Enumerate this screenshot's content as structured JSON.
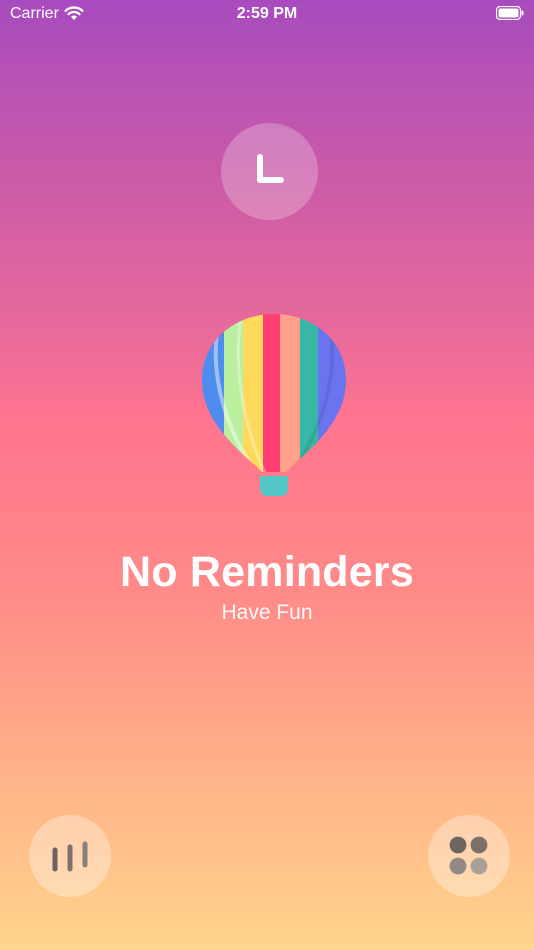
{
  "status_bar": {
    "carrier": "Carrier",
    "time": "2:59 PM"
  },
  "empty_state": {
    "title": "No Reminders",
    "subtitle": "Have Fun"
  },
  "colors": {
    "gradient_top": "#a84bbf",
    "gradient_middle": "#ff748f",
    "gradient_bottom": "#ffd58c"
  },
  "icons": {
    "wifi": "wifi-icon",
    "battery": "battery-icon",
    "clock": "clock-icon",
    "balloon": "hot-air-balloon-icon",
    "stats": "bar-chart-icon",
    "apps": "four-dots-icon"
  }
}
